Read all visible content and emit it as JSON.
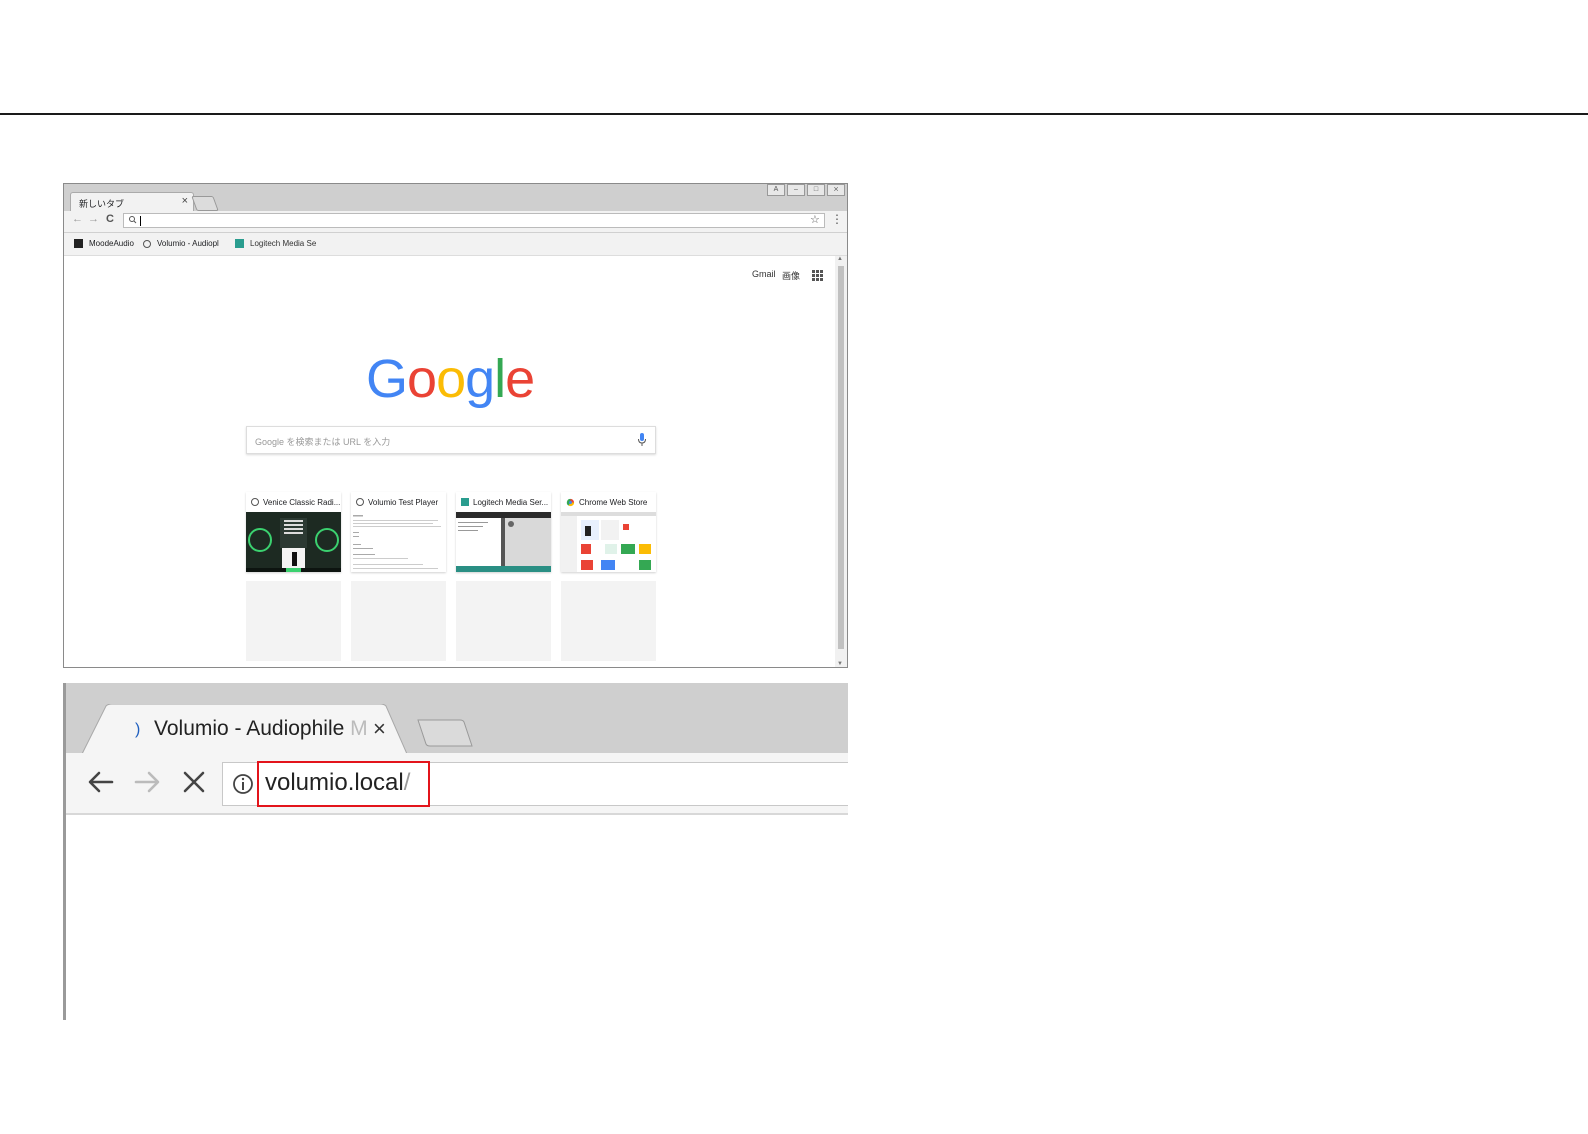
{
  "shot1": {
    "tab_title": "新しいタブ",
    "tab_close": "×",
    "nav": {
      "back": "←",
      "forward": "→",
      "reload": "C"
    },
    "omnibox_search_icon": "🔍",
    "star_icon": "☆",
    "menu_icon": "⋮",
    "bookmarks": [
      {
        "label": "MoodeAudio"
      },
      {
        "label": "Volumio - Audiopl"
      },
      {
        "label": "Logitech Media Se"
      }
    ],
    "header_links": {
      "gmail": "Gmail",
      "images": "画像"
    },
    "logo_letters": [
      {
        "ch": "G",
        "color": "#4285F4"
      },
      {
        "ch": "o",
        "color": "#EA4335"
      },
      {
        "ch": "o",
        "color": "#FBBC05"
      },
      {
        "ch": "g",
        "color": "#4285F4"
      },
      {
        "ch": "l",
        "color": "#34A853"
      },
      {
        "ch": "e",
        "color": "#EA4335"
      }
    ],
    "search_placeholder": "Google を検索または URL を入力",
    "tiles": [
      {
        "title": "Venice Classic Radi..."
      },
      {
        "title": "Volumio Test Player"
      },
      {
        "title": "Logitech Media Ser..."
      },
      {
        "title": "Chrome Web Store"
      }
    ]
  },
  "shot2": {
    "tab_title": "Volumio - Audiophile ",
    "tab_title_fade": "M",
    "tab_close": "×",
    "url": "volumio.local",
    "url_slash": "/",
    "highlight_color": "#e3141b"
  }
}
